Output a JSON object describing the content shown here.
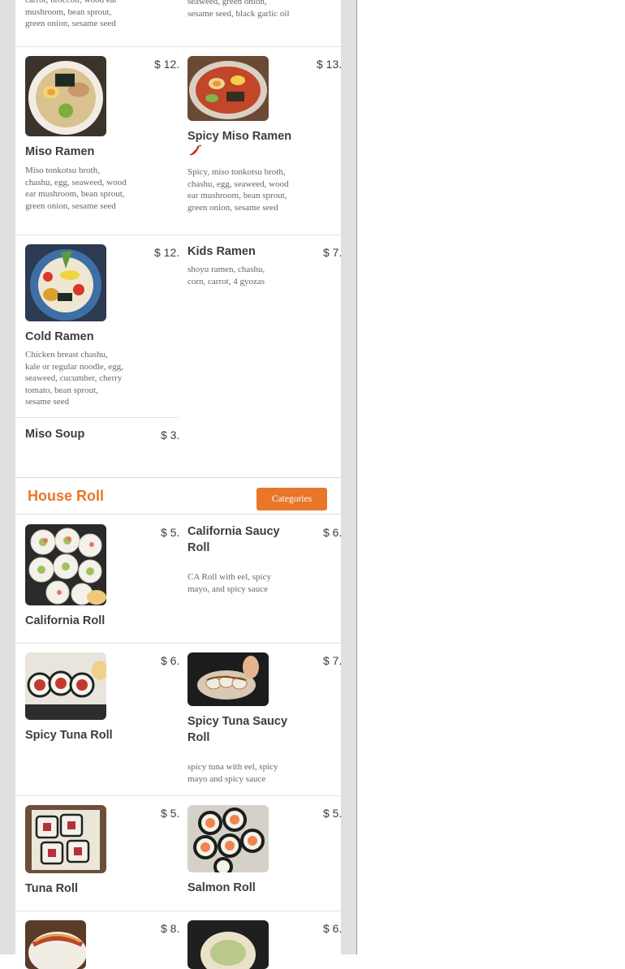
{
  "colors": {
    "accent": "#e8772a",
    "background": "#ffffff",
    "side_gutter": "#e0e0e0"
  },
  "top_items": {
    "left_desc_tail": "carrot, broccoli, wood ear mushroom, bean sprout, green onion, sesame seed",
    "right_desc_tail": "seaweed, green onion, sesame seed, black garlic oil"
  },
  "ramen": [
    {
      "name": "Miso Ramen",
      "price": "$ 12.",
      "desc": "Miso tonkotsu broth, chashu, egg, seaweed, wood ear mushroom, bean sprout, green onion, sesame seed",
      "image": "miso-ramen-photo"
    },
    {
      "name": "Spicy Miso Ramen",
      "price": "$ 13.",
      "desc": "Spicy, miso tonkotsu broth, chashu, egg, seaweed, wood ear mushroom, bean sprout, green onion, sesame seed",
      "image": "spicy-miso-ramen-photo",
      "icon": "chili-pepper-icon"
    },
    {
      "name": "Cold Ramen",
      "price": "$ 12.",
      "desc": "Chicken breast chashu, kale or regular noodle, egg, seaweed, cucumber, cherry tomato, bean sprout, sesame seed",
      "image": "cold-ramen-photo"
    },
    {
      "name": "Kids Ramen",
      "price": "$ 7.",
      "desc": "shoyu ramen, chashu, corn, carrot, 4 gyozas"
    },
    {
      "name": "Miso Soup",
      "price": "$ 3."
    }
  ],
  "house_roll": {
    "title": "House Roll",
    "categories_button": "Categories",
    "items": [
      {
        "name": "California Roll",
        "price": "$ 5.",
        "image": "california-roll-photo"
      },
      {
        "name": "California Saucy Roll",
        "price": "$ 6.",
        "desc": "CA Roll with eel, spicy mayo, and spicy sauce"
      },
      {
        "name": "Spicy Tuna Roll",
        "price": "$ 6.",
        "image": "spicy-tuna-roll-photo"
      },
      {
        "name": "Spicy Tuna Saucy Roll",
        "price": "$ 7.",
        "desc": "spicy tuna with eel, spicy mayo and spicy sauce",
        "image": "spicy-tuna-saucy-roll-photo"
      },
      {
        "name": "Tuna Roll",
        "price": "$ 5.",
        "image": "tuna-roll-photo"
      },
      {
        "name": "Salmon Roll",
        "price": "$ 5.",
        "image": "salmon-roll-photo"
      },
      {
        "price": "$ 8.",
        "image": "roll-photo"
      },
      {
        "price": "$ 6.",
        "image": "roll-photo"
      }
    ]
  }
}
